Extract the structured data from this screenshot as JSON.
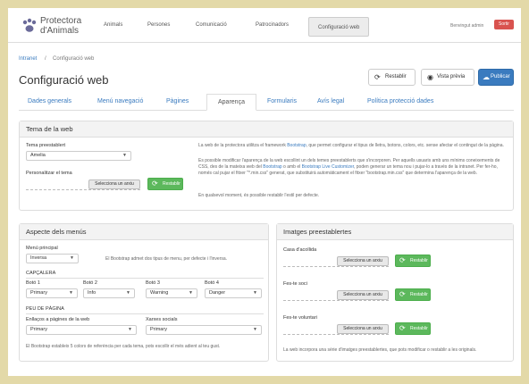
{
  "header": {
    "logo_line1": "Protectora",
    "logo_line2": "d'Animals",
    "nav": [
      "Animals",
      "Persones",
      "Comunicació",
      "Patrocinadors",
      "Configuració web"
    ],
    "welcome": "Benvingut admin",
    "logout": "Sortir"
  },
  "breadcrumb": {
    "root": "Intranet",
    "sep": "/",
    "current": "Configuració web"
  },
  "page": {
    "title": "Configuració web",
    "actions": [
      {
        "icon": "⟳",
        "label": "Restablir"
      },
      {
        "icon": "◉",
        "label": "Vista prèvia"
      },
      {
        "icon": "☁",
        "label": "Publicar"
      }
    ]
  },
  "tabs": [
    "Dades generals",
    "Menú navegació",
    "Pàgines",
    "Aparença",
    "Formularis",
    "Avís legal",
    "Política protecció dades"
  ],
  "theme": {
    "title": "Tema de la web",
    "preset_label": "Tema preestablert",
    "preset_value": "Amelia",
    "custom_label": "Personalitzar el tema",
    "upload": "Selecciona un arxiu",
    "reset": "Restablir",
    "p1a": "La web de la protectora utilitza el framework ",
    "p1_link": "Bootstrap",
    "p1b": ", que permet configurar el tipus de lletra, botons, colors, etc. sense afectar el contingut de la pàgina.",
    "p2a": "Es possible modificar l'aparença de la web escollint un dels temes preestablerts que s'incorporen. Per aquells usuaris amb uns mínims coneixements de CSS, des de la mateixa web del ",
    "p2_link1": "Bootstrap",
    "p2b": " o amb el ",
    "p2_link2": "Bootstrap Live Customizer",
    "p2c": ", poden generar un tema nou i pujar-lo a través de la intranet. Per fer-ho, només cal pujar el fitxer \"*.min.css\" generat, que substituirà automàticament el fitxer \"bootstrap.min.css\" que determina l'aparença de la web.",
    "p3": "En qualsevol moment, és possible restablir l'estil per defecte."
  },
  "menus": {
    "title": "Aspecte dels menús",
    "main_label": "Menú principal",
    "main_value": "Inversa",
    "main_help": "El Bootstrap admet dos tipus de menu, per defecte i l'inversa.",
    "header_section": "CAPÇALERA",
    "buttons": [
      {
        "label": "Botó 1",
        "value": "Primary"
      },
      {
        "label": "Botó 2",
        "value": "Info"
      },
      {
        "label": "Botó 3",
        "value": "Warning"
      },
      {
        "label": "Botó 4",
        "value": "Danger"
      }
    ],
    "footer_section": "PEU DE PÀGINA",
    "links_label": "Enllaços a pàgines de la web",
    "links_value": "Primary",
    "social_label": "Xarxes socials",
    "social_value": "Primary",
    "footer_help": "El Bootstrap estableix 5 colors de referència per cada tema, pots escollir el més adient al teu gust."
  },
  "images": {
    "title": "Imatges preestablertes",
    "items": [
      {
        "label": "Casa d'acollida",
        "upload": "Selecciona un arxiu",
        "reset": "Restablir"
      },
      {
        "label": "Fes-te soci",
        "upload": "Selecciona un arxiu",
        "reset": "Restablir"
      },
      {
        "label": "Fes-te voluntari",
        "upload": "Selecciona un arxiu",
        "reset": "Restablir"
      }
    ],
    "help": "La web incorpora una sèrie d'imatges preestablertes, que pots modificar o restablir a les originals."
  },
  "colors": {
    "accent": "#3a7bbf",
    "success": "#5cb85c",
    "danger": "#d9534f",
    "background": "#e3d9a8"
  }
}
